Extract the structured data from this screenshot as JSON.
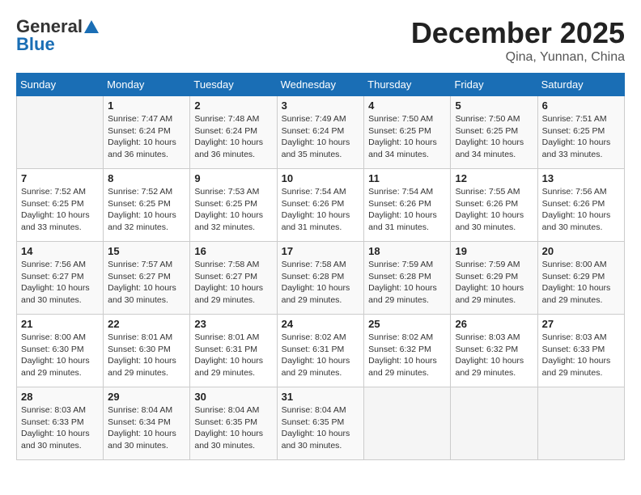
{
  "header": {
    "logo_general": "General",
    "logo_blue": "Blue",
    "month_title": "December 2025",
    "subtitle": "Qina, Yunnan, China"
  },
  "days_of_week": [
    "Sunday",
    "Monday",
    "Tuesday",
    "Wednesday",
    "Thursday",
    "Friday",
    "Saturday"
  ],
  "weeks": [
    [
      {
        "day": "",
        "sunrise": "",
        "sunset": "",
        "daylight": ""
      },
      {
        "day": "1",
        "sunrise": "Sunrise: 7:47 AM",
        "sunset": "Sunset: 6:24 PM",
        "daylight": "Daylight: 10 hours and 36 minutes."
      },
      {
        "day": "2",
        "sunrise": "Sunrise: 7:48 AM",
        "sunset": "Sunset: 6:24 PM",
        "daylight": "Daylight: 10 hours and 36 minutes."
      },
      {
        "day": "3",
        "sunrise": "Sunrise: 7:49 AM",
        "sunset": "Sunset: 6:24 PM",
        "daylight": "Daylight: 10 hours and 35 minutes."
      },
      {
        "day": "4",
        "sunrise": "Sunrise: 7:50 AM",
        "sunset": "Sunset: 6:25 PM",
        "daylight": "Daylight: 10 hours and 34 minutes."
      },
      {
        "day": "5",
        "sunrise": "Sunrise: 7:50 AM",
        "sunset": "Sunset: 6:25 PM",
        "daylight": "Daylight: 10 hours and 34 minutes."
      },
      {
        "day": "6",
        "sunrise": "Sunrise: 7:51 AM",
        "sunset": "Sunset: 6:25 PM",
        "daylight": "Daylight: 10 hours and 33 minutes."
      }
    ],
    [
      {
        "day": "7",
        "sunrise": "Sunrise: 7:52 AM",
        "sunset": "Sunset: 6:25 PM",
        "daylight": "Daylight: 10 hours and 33 minutes."
      },
      {
        "day": "8",
        "sunrise": "Sunrise: 7:52 AM",
        "sunset": "Sunset: 6:25 PM",
        "daylight": "Daylight: 10 hours and 32 minutes."
      },
      {
        "day": "9",
        "sunrise": "Sunrise: 7:53 AM",
        "sunset": "Sunset: 6:25 PM",
        "daylight": "Daylight: 10 hours and 32 minutes."
      },
      {
        "day": "10",
        "sunrise": "Sunrise: 7:54 AM",
        "sunset": "Sunset: 6:26 PM",
        "daylight": "Daylight: 10 hours and 31 minutes."
      },
      {
        "day": "11",
        "sunrise": "Sunrise: 7:54 AM",
        "sunset": "Sunset: 6:26 PM",
        "daylight": "Daylight: 10 hours and 31 minutes."
      },
      {
        "day": "12",
        "sunrise": "Sunrise: 7:55 AM",
        "sunset": "Sunset: 6:26 PM",
        "daylight": "Daylight: 10 hours and 30 minutes."
      },
      {
        "day": "13",
        "sunrise": "Sunrise: 7:56 AM",
        "sunset": "Sunset: 6:26 PM",
        "daylight": "Daylight: 10 hours and 30 minutes."
      }
    ],
    [
      {
        "day": "14",
        "sunrise": "Sunrise: 7:56 AM",
        "sunset": "Sunset: 6:27 PM",
        "daylight": "Daylight: 10 hours and 30 minutes."
      },
      {
        "day": "15",
        "sunrise": "Sunrise: 7:57 AM",
        "sunset": "Sunset: 6:27 PM",
        "daylight": "Daylight: 10 hours and 30 minutes."
      },
      {
        "day": "16",
        "sunrise": "Sunrise: 7:58 AM",
        "sunset": "Sunset: 6:27 PM",
        "daylight": "Daylight: 10 hours and 29 minutes."
      },
      {
        "day": "17",
        "sunrise": "Sunrise: 7:58 AM",
        "sunset": "Sunset: 6:28 PM",
        "daylight": "Daylight: 10 hours and 29 minutes."
      },
      {
        "day": "18",
        "sunrise": "Sunrise: 7:59 AM",
        "sunset": "Sunset: 6:28 PM",
        "daylight": "Daylight: 10 hours and 29 minutes."
      },
      {
        "day": "19",
        "sunrise": "Sunrise: 7:59 AM",
        "sunset": "Sunset: 6:29 PM",
        "daylight": "Daylight: 10 hours and 29 minutes."
      },
      {
        "day": "20",
        "sunrise": "Sunrise: 8:00 AM",
        "sunset": "Sunset: 6:29 PM",
        "daylight": "Daylight: 10 hours and 29 minutes."
      }
    ],
    [
      {
        "day": "21",
        "sunrise": "Sunrise: 8:00 AM",
        "sunset": "Sunset: 6:30 PM",
        "daylight": "Daylight: 10 hours and 29 minutes."
      },
      {
        "day": "22",
        "sunrise": "Sunrise: 8:01 AM",
        "sunset": "Sunset: 6:30 PM",
        "daylight": "Daylight: 10 hours and 29 minutes."
      },
      {
        "day": "23",
        "sunrise": "Sunrise: 8:01 AM",
        "sunset": "Sunset: 6:31 PM",
        "daylight": "Daylight: 10 hours and 29 minutes."
      },
      {
        "day": "24",
        "sunrise": "Sunrise: 8:02 AM",
        "sunset": "Sunset: 6:31 PM",
        "daylight": "Daylight: 10 hours and 29 minutes."
      },
      {
        "day": "25",
        "sunrise": "Sunrise: 8:02 AM",
        "sunset": "Sunset: 6:32 PM",
        "daylight": "Daylight: 10 hours and 29 minutes."
      },
      {
        "day": "26",
        "sunrise": "Sunrise: 8:03 AM",
        "sunset": "Sunset: 6:32 PM",
        "daylight": "Daylight: 10 hours and 29 minutes."
      },
      {
        "day": "27",
        "sunrise": "Sunrise: 8:03 AM",
        "sunset": "Sunset: 6:33 PM",
        "daylight": "Daylight: 10 hours and 29 minutes."
      }
    ],
    [
      {
        "day": "28",
        "sunrise": "Sunrise: 8:03 AM",
        "sunset": "Sunset: 6:33 PM",
        "daylight": "Daylight: 10 hours and 30 minutes."
      },
      {
        "day": "29",
        "sunrise": "Sunrise: 8:04 AM",
        "sunset": "Sunset: 6:34 PM",
        "daylight": "Daylight: 10 hours and 30 minutes."
      },
      {
        "day": "30",
        "sunrise": "Sunrise: 8:04 AM",
        "sunset": "Sunset: 6:35 PM",
        "daylight": "Daylight: 10 hours and 30 minutes."
      },
      {
        "day": "31",
        "sunrise": "Sunrise: 8:04 AM",
        "sunset": "Sunset: 6:35 PM",
        "daylight": "Daylight: 10 hours and 30 minutes."
      },
      {
        "day": "",
        "sunrise": "",
        "sunset": "",
        "daylight": ""
      },
      {
        "day": "",
        "sunrise": "",
        "sunset": "",
        "daylight": ""
      },
      {
        "day": "",
        "sunrise": "",
        "sunset": "",
        "daylight": ""
      }
    ]
  ]
}
